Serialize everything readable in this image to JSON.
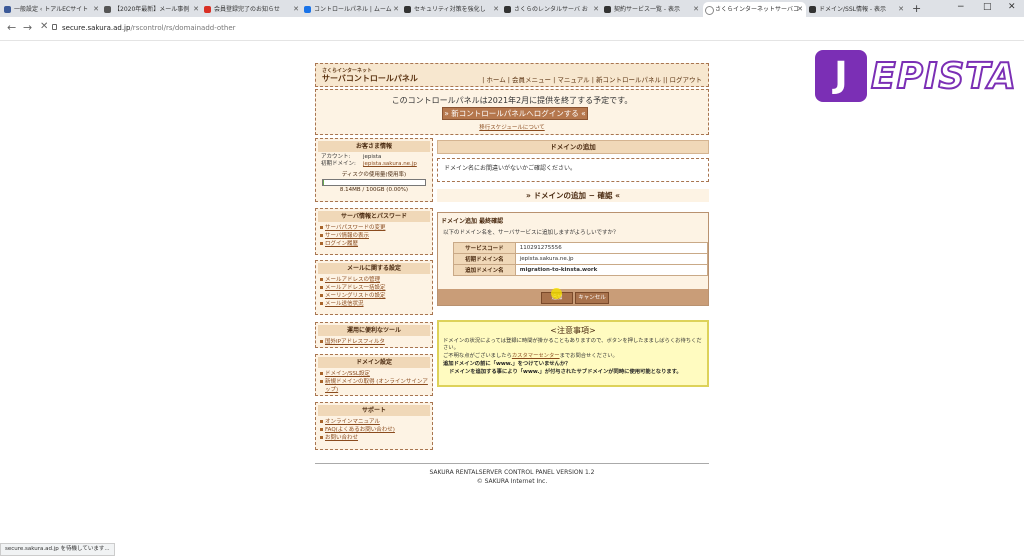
{
  "browser": {
    "tabs": [
      {
        "title": "一般設定 ‹ トアルECサイト",
        "color": "#3b5998"
      },
      {
        "title": "【2020年最新】メール事例",
        "color": "#555555"
      },
      {
        "title": "会員登録完了のお知らせ",
        "color": "#d93025"
      },
      {
        "title": "コントロールパネル | ムーム",
        "color": "#1a73e8"
      },
      {
        "title": "セキュリティ対策を強化し",
        "color": "#333333"
      },
      {
        "title": "さくらのレンタルサーバ お",
        "color": "#333333"
      },
      {
        "title": "契約サービス一覧 - 表示",
        "color": "#333333"
      },
      {
        "title": "さくらインターネットサーバコ",
        "color": "#888888",
        "active": true
      },
      {
        "title": "ドメイン/SSL情報 - 表示",
        "color": "#333333"
      }
    ],
    "url_host": "secure.sakura.ad.jp",
    "url_path": "/rscontrol/rs/domainadd-other",
    "status_text": "secure.sakura.ad.jp を待機しています..."
  },
  "logo": {
    "badge": "J",
    "word": "EPISTA"
  },
  "header": {
    "brand_small": "さくらインターネット",
    "brand": "サーバコントロールパネル",
    "nav": "| ホーム | 会員メニュー | マニュアル | 新コントロールパネル || ログアウト"
  },
  "notice": {
    "message": "このコントロールパネルは2021年2月に提供を終了する予定です。",
    "button": "» 新コントロールパネルへログインする «",
    "link": "移行スケジュールについて"
  },
  "sidebar": {
    "customer": {
      "title": "お客さま情報",
      "account_label": "アカウント:",
      "account_value": "jepista",
      "domain_label": "初期ドメイン:",
      "domain_value": "jepista.sakura.ne.jp",
      "disk_label": "ディスクの使用量(使用率)",
      "disk_usage": 0.009,
      "disk_text": "8.14MB / 100GB (0.00%)"
    },
    "server": {
      "title": "サーバ情報とパスワード",
      "items": [
        "サーバパスワードの変更",
        "サーバ情報の表示",
        "ログイン履歴"
      ]
    },
    "mail": {
      "title": "メールに関する設定",
      "items": [
        "メールアドレスの管理",
        "メールアドレス一括設定",
        "メーリングリストの設定",
        "メール送信状況"
      ]
    },
    "tools": {
      "title": "運用に便利なツール",
      "items": [
        "国外IPアドレスフィルタ"
      ]
    },
    "domain": {
      "title": "ドメイン設定",
      "items": [
        "ドメイン/SSL設定",
        "新規ドメインの取得 (オンラインサインアップ)"
      ]
    },
    "support": {
      "title": "サポート",
      "items": [
        "オンラインマニュアル",
        "FAQ(よくあるお問い合わせ)",
        "お問い合わせ"
      ]
    }
  },
  "main": {
    "title": "ドメインの追加",
    "confirm_message": "ドメイン名にお間違いがないかご確認ください。",
    "step_title": "» ドメインの追加 − 確認 «",
    "final_title": "ドメイン追加 最終確認",
    "final_question": "以下のドメイン名を、サーバサービスに追加しますがよろしいですか？",
    "rows": [
      {
        "label": "サービスコード",
        "value": "110291275556"
      },
      {
        "label": "初期ドメイン名",
        "value": "jepista.sakura.ne.jp"
      },
      {
        "label": "追加ドメイン名",
        "value": "migration-to-kinsta.work"
      }
    ],
    "submit_button": "追加",
    "cancel_button": "キャンセル"
  },
  "caution": {
    "title": "<注意事項>",
    "line1": "ドメインの状況によっては登録に時間が掛かることもありますので、ボタンを押したまましばらくお待ちください。",
    "line2_pre": "ご不明な点がございましたら",
    "line2_link": "カスタマーセンター",
    "line2_post": "までお問合せください。",
    "line3": "追加ドメインの前に「www.」をつけていませんか？",
    "line4": "ドメインを追加する事により「www.」が付与されたサブドメインが同時に使用可能となります。"
  },
  "footer": {
    "version": "SAKURA RENTALSERVER CONTROL PANEL VERSION 1.2",
    "copyright": "© SAKURA Internet Inc."
  }
}
